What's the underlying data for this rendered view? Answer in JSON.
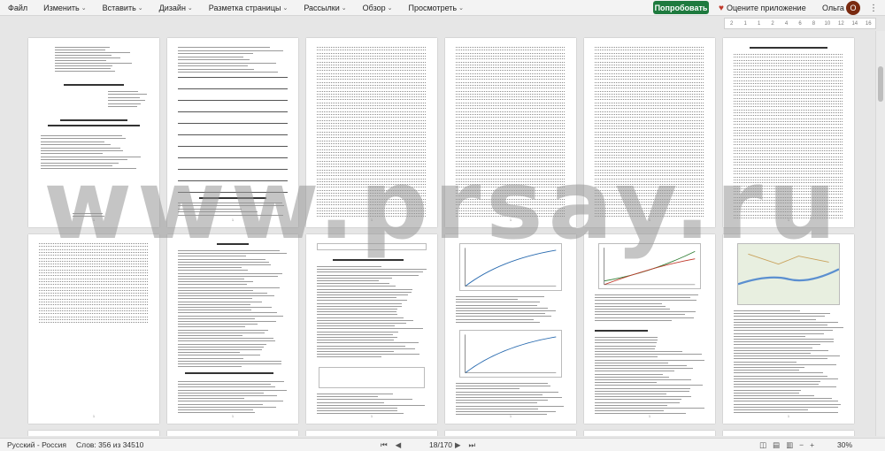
{
  "menu": [
    {
      "label": "Файл"
    },
    {
      "label": "Изменить",
      "chev": "⌄"
    },
    {
      "label": "Вставить",
      "chev": "⌄"
    },
    {
      "label": "Дизайн",
      "chev": "⌄"
    },
    {
      "label": "Разметка страницы",
      "chev": "⌄"
    },
    {
      "label": "Рассылки",
      "chev": "⌄"
    },
    {
      "label": "Обзор",
      "chev": "⌄"
    },
    {
      "label": "Просмотреть",
      "chev": "⌄"
    }
  ],
  "try_button": "Попробовать",
  "rate_label": "Оцените приложение",
  "user_name": "Ольга",
  "avatar_letter": "О",
  "more_icon": "⋮",
  "ruler_marks": [
    "2",
    "1",
    "1",
    "2",
    "4",
    "6",
    "8",
    "10",
    "12",
    "14",
    "16"
  ],
  "watermark": "www.prsay.ru",
  "page_label": "1",
  "status": {
    "language": "Русский - Россия",
    "words": "Слов: 356 из 34510",
    "page": "18/170",
    "zoom": "30%"
  }
}
